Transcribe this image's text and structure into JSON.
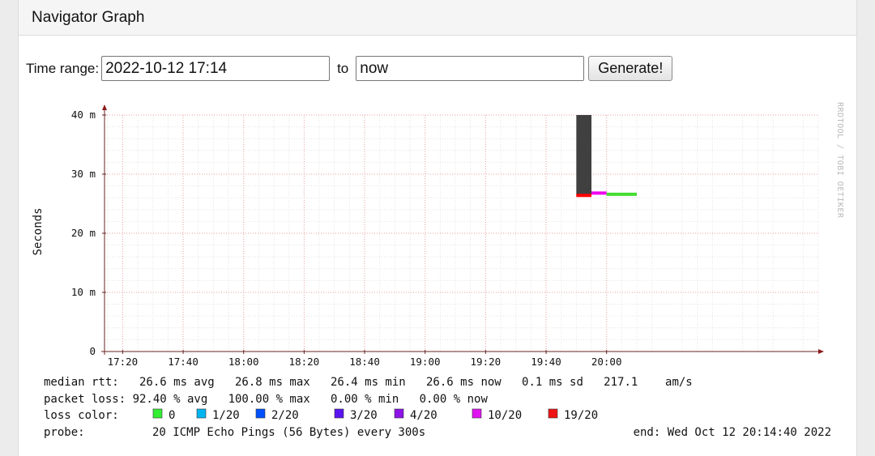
{
  "panel": {
    "title": "Navigator Graph"
  },
  "controls": {
    "time_range_label": "Time range:",
    "start_value": "2022-10-12 17:14",
    "to_label": "to",
    "end_value": "now",
    "generate_label": "Generate!"
  },
  "watermark": "RRDTOOL / TOBI OETIKER",
  "chart_data": {
    "type": "line",
    "ylabel": "Seconds",
    "ylim": [
      0,
      40
    ],
    "y_unit": "m",
    "y_ticks": [
      {
        "value": 0,
        "label": "0"
      },
      {
        "value": 10,
        "label": "10 m"
      },
      {
        "value": 20,
        "label": "20 m"
      },
      {
        "value": 30,
        "label": "30 m"
      },
      {
        "value": 40,
        "label": "40 m"
      }
    ],
    "xlim": [
      "17:14",
      "21:10"
    ],
    "x_ticks": [
      "17:20",
      "17:40",
      "18:00",
      "18:20",
      "18:40",
      "19:00",
      "19:20",
      "19:40",
      "20:00"
    ],
    "grid": true,
    "smoke_band": {
      "x_start": "19:50",
      "x_end": "19:55",
      "low_ms": 26.4,
      "high_ms": 40,
      "color": "#404040"
    },
    "series": [
      {
        "name": "19/20",
        "color": "#ff0000",
        "x": [
          "19:50",
          "19:55"
        ],
        "values": [
          26.4,
          26.4
        ]
      },
      {
        "name": "10/20",
        "color": "#ee00ee",
        "x": [
          "19:55",
          "20:00"
        ],
        "values": [
          26.8,
          26.8
        ]
      },
      {
        "name": "0",
        "color": "#44dd33",
        "x": [
          "20:00",
          "20:10"
        ],
        "values": [
          26.6,
          26.6
        ]
      }
    ]
  },
  "legend": {
    "median_rtt": "median rtt:   26.6 ms avg   26.8 ms max   26.4 ms min   26.6 ms now   0.1 ms sd   217.1    am/s",
    "packet_loss": "packet loss: 92.40 % avg   100.00 % max   0.00 % min   0.00 % now",
    "loss_color_label": "loss color:",
    "loss_colors": [
      {
        "label": "0",
        "color": "#33ee33"
      },
      {
        "label": "1/20",
        "color": "#00b4f0"
      },
      {
        "label": "2/20",
        "color": "#0050ff"
      },
      {
        "label": "3/20",
        "color": "#5a14f0"
      },
      {
        "label": "4/20",
        "color": "#8c14e6"
      },
      {
        "label": "10/20",
        "color": "#e014f0"
      },
      {
        "label": "19/20",
        "color": "#f01414"
      }
    ],
    "probe_label": "probe:",
    "probe_desc": "20 ICMP Echo Pings (56 Bytes) every 300s",
    "end_text": "end: Wed Oct 12 20:14:40 2022"
  }
}
